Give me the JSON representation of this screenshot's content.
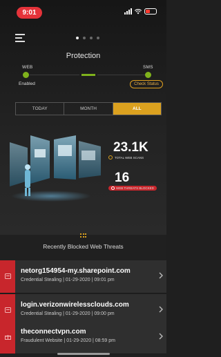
{
  "status_bar": {
    "time": "9:01"
  },
  "header": {
    "page_dots_active": 1,
    "page_dots_total": 4
  },
  "protection": {
    "title": "Protection",
    "web_label": "WEB",
    "sms_label": "SMS",
    "web_status": "Enabled",
    "check_status": "Check Status"
  },
  "tabs": [
    {
      "label": "TODAY",
      "active": false
    },
    {
      "label": "MONTH",
      "active": false
    },
    {
      "label": "ALL",
      "active": true
    }
  ],
  "stats": {
    "total_scans_value": "23.1K",
    "total_scans_label": "TOTAL WEB SCANS",
    "threats_value": "16",
    "threats_label": "WEB THREATS BLOCKED"
  },
  "recent": {
    "title": "Recently Blocked Web Threats"
  },
  "threats": [
    {
      "domain": "netorg154954-my.sharepoint.com",
      "meta": "Credential Stealing | 01-29-2020 | 09:01 pm",
      "icon": "credential-card-icon"
    },
    {
      "domain": "login.verizonwirelessclouds.com",
      "meta": "Credential Stealing | 01-29-2020 | 09:00 pm",
      "icon": "credential-card-icon"
    },
    {
      "domain": "theconnectvpn.com",
      "meta": "Fraudulent Website | 01-29-2020 | 08:59 pm",
      "icon": "fraud-gift-icon"
    }
  ],
  "colors": {
    "accent": "#dba11f",
    "enabled": "#7fb21c",
    "danger": "#c8262c"
  }
}
